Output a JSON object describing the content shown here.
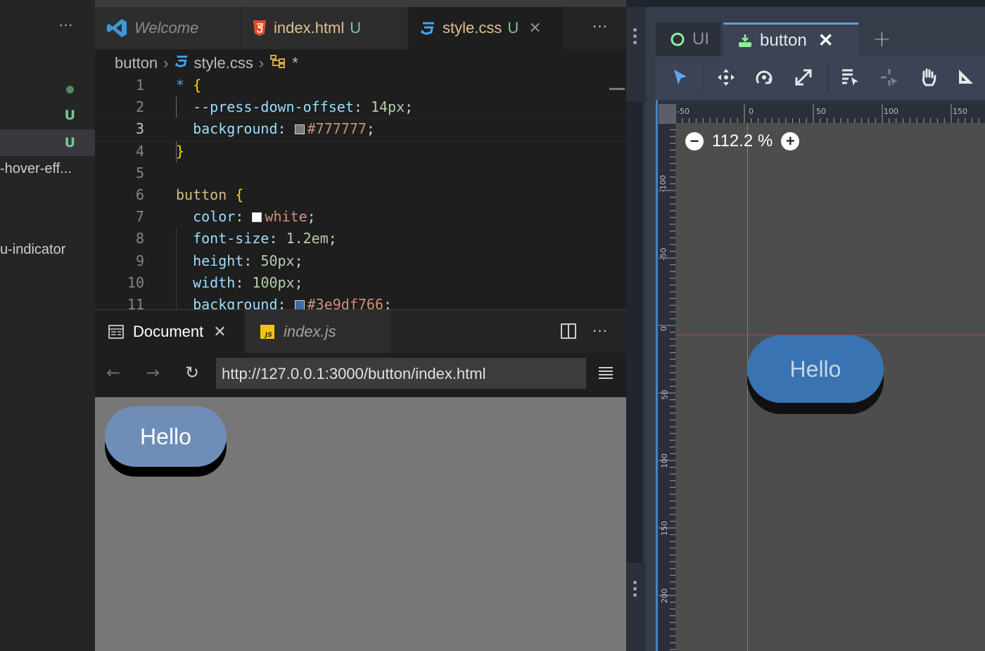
{
  "sidebar": {
    "more": "···",
    "rows": [
      {
        "text": "",
        "badge": "dot"
      },
      {
        "text": "",
        "badge": "U"
      },
      {
        "text": "",
        "badge": "U"
      },
      {
        "text": "-hover-eff...",
        "badge": ""
      },
      {
        "text": "u-indicator",
        "badge": ""
      }
    ]
  },
  "editor_tabs": [
    {
      "label": "Welcome",
      "icon": "vscode-icon",
      "modified": ""
    },
    {
      "label": "index.html",
      "icon": "html5-icon",
      "modified": "U"
    },
    {
      "label": "style.css",
      "icon": "css3-icon",
      "modified": "U",
      "close": "✕"
    }
  ],
  "editor_more": "···",
  "breadcrumb": {
    "folder": "button",
    "file": "style.css",
    "symbol": "*"
  },
  "code": {
    "line_numbers": [
      "1",
      "2",
      "3",
      "4",
      "5",
      "6",
      "7",
      "8",
      "9",
      "10",
      "11"
    ],
    "l1_sel": "*",
    "l1_brace": "{",
    "l2_prop": "--press-down-offset",
    "l2_val": "14px",
    "l3_prop": "background",
    "l3_val": "#777777",
    "l4_brace": "}",
    "l6_sel": "button",
    "l6_brace": "{",
    "l7_prop": "color",
    "l7_val": "white",
    "l8_prop": "font-size",
    "l8_val": "1.2em",
    "l9_prop": "height",
    "l9_val": "50px",
    "l10_prop": "width",
    "l10_val": "100px",
    "l11_prop": "background",
    "l11_val": "#3e9df766"
  },
  "swatches": {
    "gray": "#777777",
    "white": "#ffffff",
    "blue": "#3e6aa8"
  },
  "panel_tabs": [
    {
      "label": "Document",
      "icon": "document-icon",
      "close": "✕"
    },
    {
      "label": "index.js",
      "icon": "javascript-icon"
    }
  ],
  "panel_more": "···",
  "browser": {
    "url": "http://127.0.0.1:3000/button/index.html",
    "button_label": "Hello"
  },
  "godot": {
    "tabs": [
      {
        "label": "UI"
      },
      {
        "label": "button",
        "close": "✕"
      }
    ],
    "add": "+",
    "zoom": "112.2 %",
    "zoom_out": "−",
    "zoom_in": "+",
    "hruler_labels": [
      "-50",
      "0",
      "50",
      "100",
      "150"
    ],
    "vruler_labels": [
      "-100",
      "-50",
      "0",
      "50",
      "100",
      "150",
      "200"
    ],
    "button_label": "Hello"
  },
  "colors": {
    "accent_green": "#73c991",
    "tab_accent": "#5f9bd8",
    "button_blue": "#3a73b2"
  }
}
